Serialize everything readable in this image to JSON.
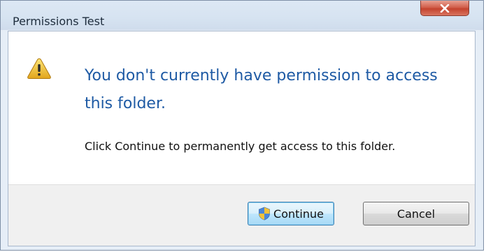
{
  "window": {
    "title": "Permissions Test",
    "close_symbol": "x"
  },
  "message": {
    "icon": "warning-icon",
    "heading": "You don't currently have permission to access this folder.",
    "body": "Click Continue to permanently get access to this folder."
  },
  "buttons": {
    "continue_label": "Continue",
    "continue_icon": "uac-shield-icon",
    "cancel_label": "Cancel"
  },
  "colors": {
    "heading": "#1e5aa4",
    "close_button": "#c4432e",
    "footer": "#f0f0f0"
  }
}
